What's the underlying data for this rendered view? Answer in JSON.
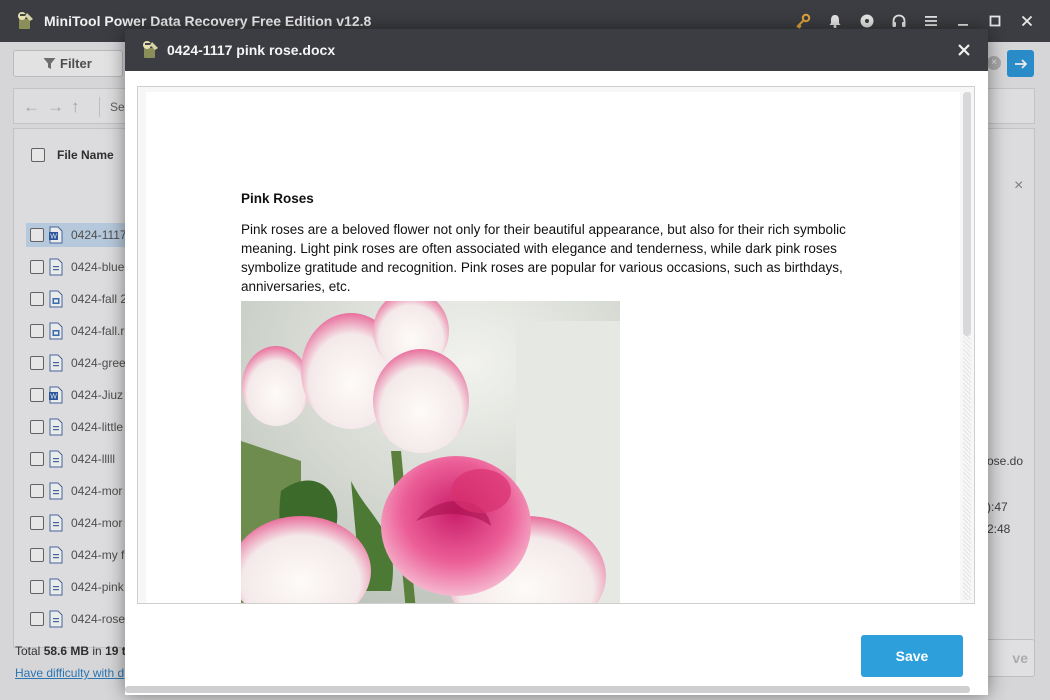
{
  "app": {
    "title": "MiniTool Power Data Recovery Free Edition v12.8",
    "title_icons": [
      "key-icon",
      "bell-icon",
      "disc-icon",
      "headset-icon",
      "menu-icon",
      "minimize-icon",
      "maximize-icon",
      "close-icon"
    ]
  },
  "toolbar": {
    "filter_label": "Filter"
  },
  "nav": {
    "path_text": "Se"
  },
  "file_list": {
    "header_label": "File Name",
    "rows": [
      {
        "name": "0424-1117",
        "selected": true,
        "icon": "word-doc-icon"
      },
      {
        "name": "0424-blue",
        "selected": false,
        "icon": "text-doc-icon"
      },
      {
        "name": "0424-fall 2",
        "selected": false,
        "icon": "image-doc-icon"
      },
      {
        "name": "0424-fall.r",
        "selected": false,
        "icon": "image-doc-icon"
      },
      {
        "name": "0424-gree",
        "selected": false,
        "icon": "text-doc-icon"
      },
      {
        "name": "0424-Jiuz",
        "selected": false,
        "icon": "word-doc-icon"
      },
      {
        "name": "0424-little",
        "selected": false,
        "icon": "text-doc-icon"
      },
      {
        "name": "0424-lllll",
        "selected": false,
        "icon": "text-doc-icon"
      },
      {
        "name": "0424-mor",
        "selected": false,
        "icon": "text-doc-icon"
      },
      {
        "name": "0424-mor",
        "selected": false,
        "icon": "text-doc-icon"
      },
      {
        "name": "0424-my f",
        "selected": false,
        "icon": "text-doc-icon"
      },
      {
        "name": "0424-pink",
        "selected": false,
        "icon": "text-doc-icon"
      },
      {
        "name": "0424-rose",
        "selected": false,
        "icon": "text-doc-icon"
      }
    ]
  },
  "side_info": {
    "filename_fragment": "ose.do",
    "time1": "):47",
    "time2": "2:48"
  },
  "footer": {
    "total_prefix": "Total ",
    "total_size": "58.6 MB",
    "total_mid": " in ",
    "total_count": "19 t",
    "help_link": "Have difficulty with d",
    "save_label_partial": "ve"
  },
  "preview": {
    "title": "0424-1117 pink rose.docx",
    "doc_heading": "Pink Roses",
    "doc_paragraph": "Pink roses are a beloved flower not only for their beautiful appearance, but also for their rich symbolic meaning. Light pink roses are often associated with elegance and tenderness, while dark pink roses symbolize gratitude and recognition. Pink roses are popular for various occasions, such as birthdays, anniversaries, etc.",
    "save_label": "Save"
  },
  "colors": {
    "titlebar": "#3c3d42",
    "accent": "#2d9fdb",
    "selection": "#c6dbef"
  }
}
